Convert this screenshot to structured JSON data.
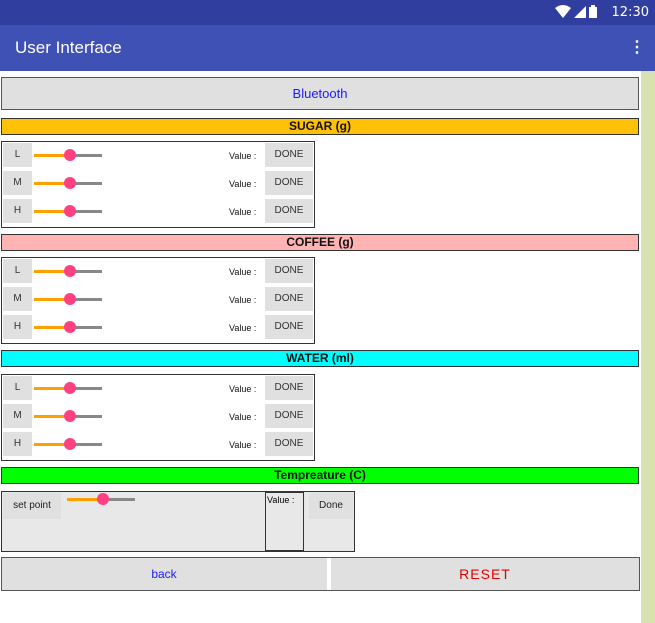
{
  "status": {
    "time": "12:30"
  },
  "app": {
    "title": "User Interface"
  },
  "bluetooth_label": "Bluetooth",
  "sections": [
    {
      "title": "SUGAR (g)",
      "color": "#ffc107",
      "rows": [
        {
          "level": "L",
          "value_label": "Value :",
          "done": "DONE"
        },
        {
          "level": "M",
          "value_label": "Value :",
          "done": "DONE"
        },
        {
          "level": "H",
          "value_label": "Value :",
          "done": "DONE"
        }
      ]
    },
    {
      "title": "COFFEE (g)",
      "color": "#ffb3b3",
      "rows": [
        {
          "level": "L",
          "value_label": "Value :",
          "done": "DONE"
        },
        {
          "level": "M",
          "value_label": "Value :",
          "done": "DONE"
        },
        {
          "level": "H",
          "value_label": "Value :",
          "done": "DONE"
        }
      ]
    },
    {
      "title": "WATER (ml)",
      "color": "#00ffff",
      "rows": [
        {
          "level": "L",
          "value_label": "Value :",
          "done": "DONE"
        },
        {
          "level": "M",
          "value_label": "Value :",
          "done": "DONE"
        },
        {
          "level": "H",
          "value_label": "Value :",
          "done": "DONE"
        }
      ]
    }
  ],
  "temperature": {
    "title": "Tempreature (C)",
    "color": "#00ff00",
    "setpoint_label": "set point",
    "value_label": "Value :",
    "done": "Done"
  },
  "footer": {
    "back": "back",
    "reset": "RESET"
  }
}
